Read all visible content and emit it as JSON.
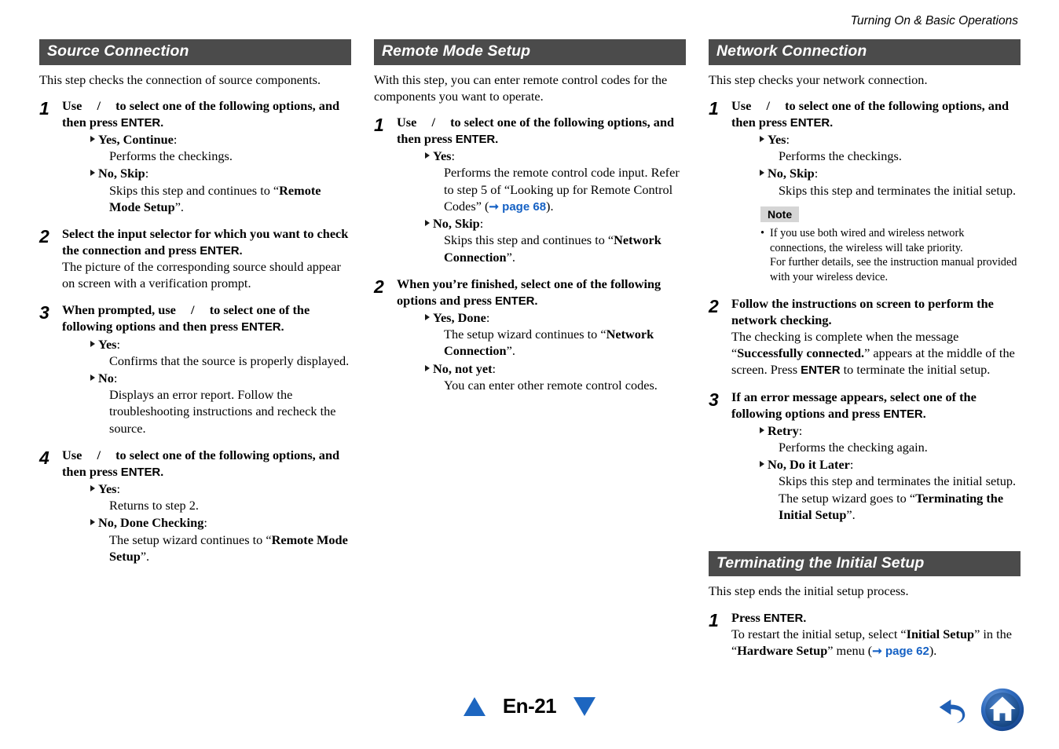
{
  "header": {
    "running_head": "Turning On & Basic Operations"
  },
  "colors": {
    "section_bar": "#4b4b4b",
    "link_blue": "#1561c4",
    "note_badge": "#d5d5d5",
    "nav_blue": "#1d66c0"
  },
  "columns": [
    {
      "sections": [
        {
          "title": "Source Connection",
          "intro": "This step checks the connection of source components.",
          "steps": [
            {
              "num": "1",
              "title_pre": "Use ",
              "title_mid": " / ",
              "title_post": " to select one of the following options, and then press ",
              "title_key": "ENTER.",
              "options": [
                {
                  "label": "Yes, Continue",
                  "text": "Performs the checkings."
                },
                {
                  "label": "No, Skip",
                  "text_pre": "Skips this step and continues to “",
                  "text_bold": "Remote Mode Setup",
                  "text_post": "”."
                }
              ]
            },
            {
              "num": "2",
              "title_plain_pre": "Select the input selector for which you want to check the connection and press ",
              "title_key": "ENTER.",
              "desc": "The picture of the corresponding source should appear on screen with a verification prompt.",
              "options": []
            },
            {
              "num": "3",
              "title_pre": "When prompted, use ",
              "title_mid": " / ",
              "title_post": " to select one of the following options and then press ",
              "title_key": "ENTER.",
              "options": [
                {
                  "label": "Yes",
                  "text": "Confirms that the source is properly displayed."
                },
                {
                  "label": "No",
                  "text": "Displays an error report. Follow the troubleshooting instructions and recheck the source."
                }
              ]
            },
            {
              "num": "4",
              "title_pre": "Use ",
              "title_mid": " / ",
              "title_post": " to select one of the following options, and then press ",
              "title_key": "ENTER.",
              "options": [
                {
                  "label": "Yes",
                  "text": "Returns to step 2."
                },
                {
                  "label": "No, Done Checking",
                  "text_pre": "The setup wizard continues to “",
                  "text_bold": "Remote Mode Setup",
                  "text_post": "”."
                }
              ]
            }
          ]
        }
      ]
    },
    {
      "sections": [
        {
          "title": "Remote Mode Setup",
          "intro": "With this step, you can enter remote control codes for the components you want to operate.",
          "steps": [
            {
              "num": "1",
              "title_pre": "Use ",
              "title_mid": " / ",
              "title_post": " to select one of the following options, and then press ",
              "title_key": "ENTER.",
              "options": [
                {
                  "label": "Yes",
                  "text_pre": "Performs the remote control code input. Refer to step 5 of “Looking up for Remote Control Codes” (",
                  "pageref": "page 68",
                  "text_post": ")."
                },
                {
                  "label": "No, Skip",
                  "text_pre": "Skips this step and continues to “",
                  "text_bold": "Network Connection",
                  "text_post": "”."
                }
              ]
            },
            {
              "num": "2",
              "title_plain_pre": "When you’re finished, select one of the following options and press ",
              "title_key": "ENTER.",
              "options": [
                {
                  "label": "Yes, Done",
                  "text_pre": "The setup wizard continues to “",
                  "text_bold": "Network Connection",
                  "text_post": "”."
                },
                {
                  "label": "No, not yet",
                  "text": "You can enter other remote control codes."
                }
              ]
            }
          ]
        }
      ]
    },
    {
      "sections": [
        {
          "title": "Network Connection",
          "intro": "This step checks your network connection.",
          "steps": [
            {
              "num": "1",
              "title_pre": "Use ",
              "title_mid": " / ",
              "title_post": " to select one of the following options, and then press ",
              "title_key": "ENTER.",
              "options": [
                {
                  "label": "Yes",
                  "text": "Performs the checkings."
                },
                {
                  "label": "No, Skip",
                  "text": "Skips this step and terminates the initial setup."
                }
              ],
              "note": {
                "badge": "Note",
                "items": [
                  "If you use both wired and wireless network connections, the wireless will take priority."
                ],
                "sub": "For further details, see the instruction manual provided with your wireless device."
              }
            },
            {
              "num": "2",
              "title_plain_pre": "Follow the instructions on screen to perform the network checking.",
              "desc_pre": "The checking is complete when the message “",
              "desc_bold": "Successfully connected.",
              "desc_mid": "” appears at the middle of the screen. Press ",
              "desc_key": "ENTER",
              "desc_post": " to terminate the initial setup.",
              "options": []
            },
            {
              "num": "3",
              "title_plain_pre": "If an error message appears, select one of the following options and press ",
              "title_key": "ENTER.",
              "options": [
                {
                  "label": "Retry",
                  "text": "Performs the checking again."
                },
                {
                  "label": "No, Do it Later",
                  "text_pre": "Skips this step and terminates the initial setup. The setup wizard goes to “",
                  "text_bold": "Terminating the Initial Setup",
                  "text_post": "”."
                }
              ]
            }
          ]
        },
        {
          "title": "Terminating the Initial Setup",
          "intro": "This step ends the initial setup process.",
          "steps": [
            {
              "num": "1",
              "title_plain_pre": "Press ",
              "title_key": "ENTER.",
              "desc_pre": "To restart the initial setup, select “",
              "desc_bold": "Initial Setup",
              "desc_mid": "” in the “",
              "desc_bold2": "Hardware Setup",
              "desc_mid2": "” menu (",
              "pageref": "page 62",
              "desc_post": ").",
              "options": []
            }
          ]
        }
      ]
    }
  ],
  "footer": {
    "prev_label": "previous-page",
    "page_number": "En-21",
    "next_label": "next-page",
    "back_label": "back",
    "home_label": "home"
  }
}
